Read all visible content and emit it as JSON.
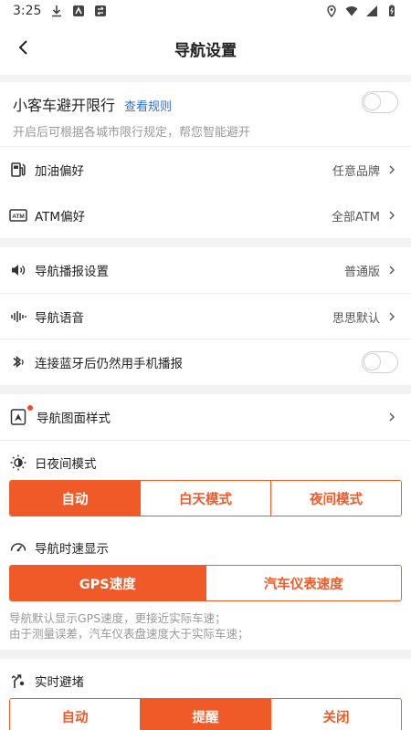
{
  "status_bar": {
    "time": "3:25"
  },
  "header": {
    "title": "导航设置"
  },
  "avoid_limit": {
    "title": "小客车避开限行",
    "link": "查看规则",
    "subtitle": "开启后可根据各城市限行规定，帮您智能避开",
    "toggle_on": false
  },
  "fuel_pref": {
    "label": "加油偏好",
    "value": "任意品牌"
  },
  "atm_pref": {
    "label": "ATM偏好",
    "value": "全部ATM"
  },
  "broadcast": {
    "label": "导航播报设置",
    "value": "普通版"
  },
  "voice": {
    "label": "导航语音",
    "value": "思思默认"
  },
  "bluetooth": {
    "label": "连接蓝牙后仍然用手机播报",
    "toggle_on": false
  },
  "map_style": {
    "label": "导航图面样式"
  },
  "day_night": {
    "label": "日夜间模式",
    "options": [
      "自动",
      "白天模式",
      "夜间模式"
    ],
    "selected": "自动"
  },
  "speed_display": {
    "label": "导航时速显示",
    "options": [
      "GPS速度",
      "汽车仪表速度"
    ],
    "selected": "GPS速度",
    "note_line1": "导航默认显示GPS速度，更接近实际车速；",
    "note_line2": "由于测量误差，汽车仪表盘速度大于实际车速；"
  },
  "avoid_jam": {
    "label": "实时避堵",
    "options": [
      "自动",
      "提醒",
      "关闭"
    ],
    "selected": "提醒"
  },
  "colors": {
    "accent": "#f05a28",
    "link": "#2f6fdc"
  }
}
